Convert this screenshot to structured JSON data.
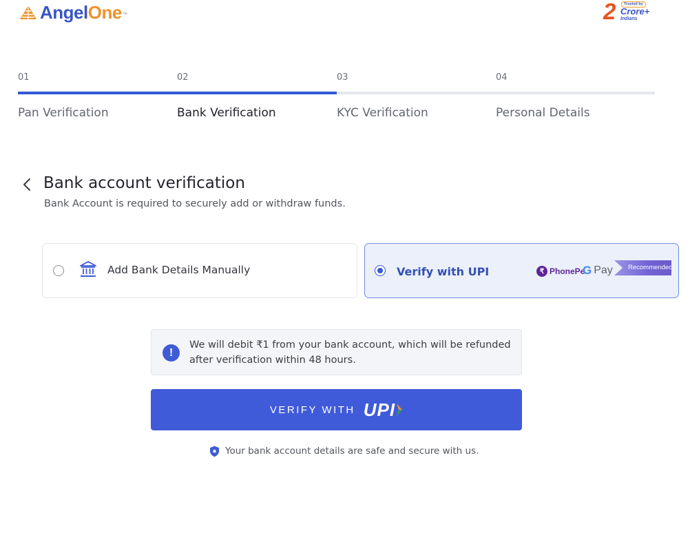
{
  "header": {
    "brand_part1": "Angel",
    "brand_part2": "One",
    "brand_tm": "™",
    "trust_badge": {
      "number": "2",
      "top": "Trusted by",
      "main": "Crore+",
      "sub": "Indians"
    }
  },
  "stepper": {
    "progress_fraction": 0.5,
    "steps": [
      {
        "number": "01",
        "label": "Pan Verification",
        "state": "done"
      },
      {
        "number": "02",
        "label": "Bank Verification",
        "state": "active"
      },
      {
        "number": "03",
        "label": "KYC Verification",
        "state": "pending"
      },
      {
        "number": "04",
        "label": "Personal Details",
        "state": "pending"
      }
    ]
  },
  "section": {
    "title": "Bank account verification",
    "subtitle": "Bank Account is required to securely add or withdraw funds."
  },
  "options": {
    "manual": {
      "label": "Add Bank Details Manually",
      "selected": false
    },
    "upi": {
      "label": "Verify with UPI",
      "selected": true,
      "phonepe_text": "PhonePe",
      "gpay_g": "G",
      "gpay_text": "Pay",
      "badge": "Recommended"
    }
  },
  "info": {
    "icon_text": "!",
    "text": "We will debit ₹1 from your bank account, which will be refunded after verification within 48 hours."
  },
  "verify_button": {
    "label": "VERIFY WITH",
    "upi_text": "UPI"
  },
  "secure_note": "Your bank account details are safe and secure with us.",
  "colors": {
    "primary": "#3f5bd9",
    "progress": "#3459d3",
    "brand_blue": "#3a56c4",
    "brand_orange": "#f0922b",
    "selected_bg": "#ecf0fa"
  },
  "icons": {
    "back": "chevron-left-icon",
    "bank": "bank-icon",
    "info": "exclamation-icon",
    "secure": "shield-check-icon"
  }
}
